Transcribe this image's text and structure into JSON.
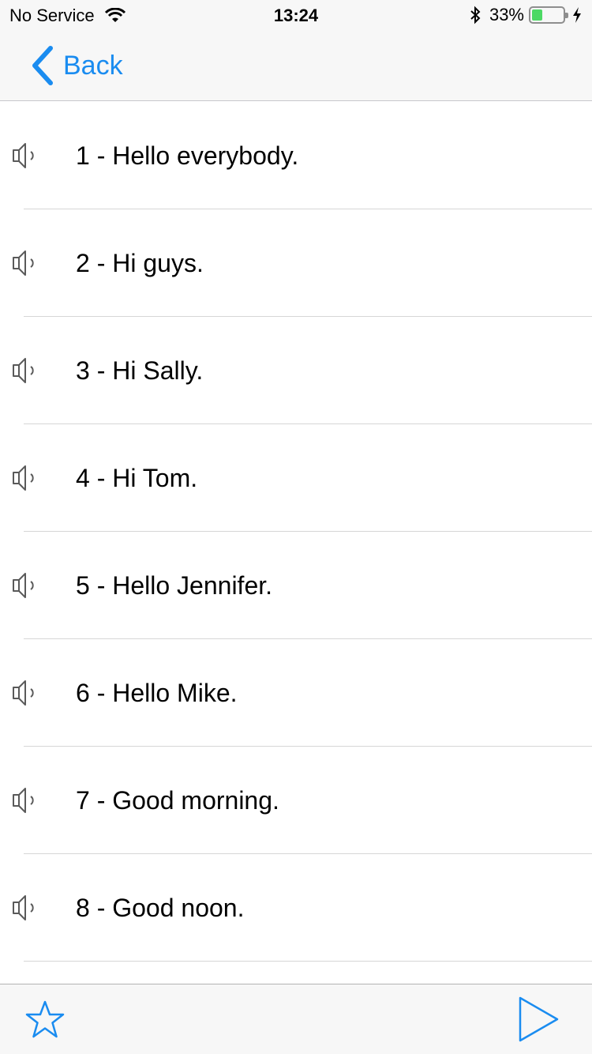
{
  "status_bar": {
    "carrier": "No Service",
    "time": "13:24",
    "battery_percent": "33%",
    "battery_level": 0.33,
    "icons": [
      "wifi-icon",
      "bluetooth-icon",
      "battery-icon",
      "charging-bolt-icon"
    ]
  },
  "nav": {
    "back_label": "Back",
    "back_icon": "chevron-left-icon"
  },
  "phrases": [
    "1 - Hello everybody.",
    "2 - Hi guys.",
    "3 - Hi Sally.",
    "4 - Hi Tom.",
    "5 - Hello Jennifer.",
    "6 - Hello Mike.",
    "7 - Good morning.",
    "8 - Good noon."
  ],
  "row_icon": "speaker-icon",
  "toolbar": {
    "left_icon": "star-icon",
    "right_icon": "play-icon"
  },
  "colors": {
    "accent": "#1a8cf0",
    "bar_background": "#f7f7f7",
    "separator": "#d6d6d6",
    "battery_fill": "#4cd964"
  }
}
